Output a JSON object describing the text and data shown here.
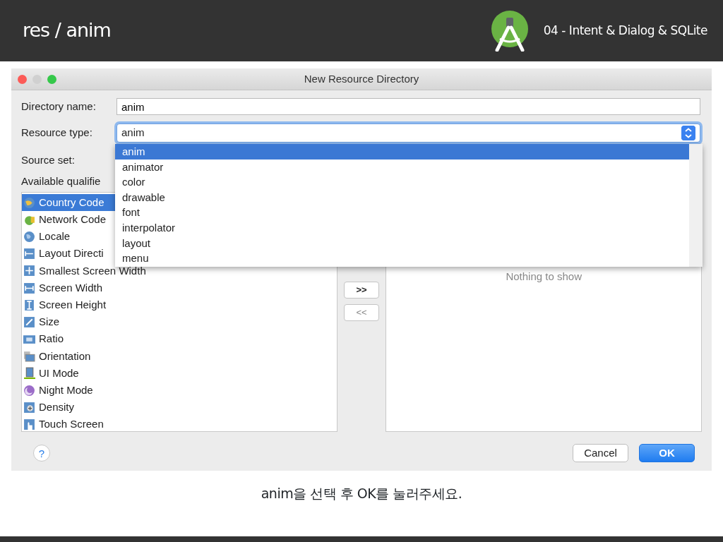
{
  "slide": {
    "title": "res / anim",
    "chapter": "04 - Intent & Dialog & SQLite"
  },
  "dialog": {
    "title": "New Resource Directory",
    "directory_name": {
      "label": "Directory name:",
      "value": "anim"
    },
    "resource_type": {
      "label": "Resource type:",
      "value": "anim",
      "focused": true
    },
    "source_set": {
      "label": "Source set:"
    },
    "available_qualifiers": {
      "label": "Available qualifie",
      "items": [
        {
          "label": "Country Code",
          "selected": true
        },
        {
          "label": "Network Code",
          "selected": false
        },
        {
          "label": "Locale",
          "selected": false
        },
        {
          "label": "Layout Directi",
          "selected": false
        },
        {
          "label": "Smallest Screen Width",
          "selected": false
        },
        {
          "label": "Screen Width",
          "selected": false
        },
        {
          "label": "Screen Height",
          "selected": false
        },
        {
          "label": "Size",
          "selected": false
        },
        {
          "label": "Ratio",
          "selected": false
        },
        {
          "label": "Orientation",
          "selected": false
        },
        {
          "label": "UI Mode",
          "selected": false
        },
        {
          "label": "Night Mode",
          "selected": false
        },
        {
          "label": "Density",
          "selected": false
        },
        {
          "label": "Touch Screen",
          "selected": false
        }
      ]
    },
    "add_button": {
      "label": ">>",
      "disabled": false
    },
    "remove_button": {
      "label": "<<",
      "disabled": true
    },
    "chosen_list": {
      "empty_text": "Nothing to show"
    },
    "help_button": {
      "label": "?"
    },
    "buttons": [
      {
        "label": "Cancel",
        "default": false
      },
      {
        "label": "OK",
        "default": true
      }
    ],
    "dropdown": {
      "options": [
        {
          "label": "anim",
          "selected": true
        },
        {
          "label": "animator",
          "selected": false
        },
        {
          "label": "color",
          "selected": false
        },
        {
          "label": "drawable",
          "selected": false
        },
        {
          "label": "font",
          "selected": false
        },
        {
          "label": "interpolator",
          "selected": false
        },
        {
          "label": "layout",
          "selected": false
        },
        {
          "label": "menu",
          "selected": false
        }
      ]
    }
  },
  "caption": "anim을 선택 후 OK를 눌러주세요."
}
